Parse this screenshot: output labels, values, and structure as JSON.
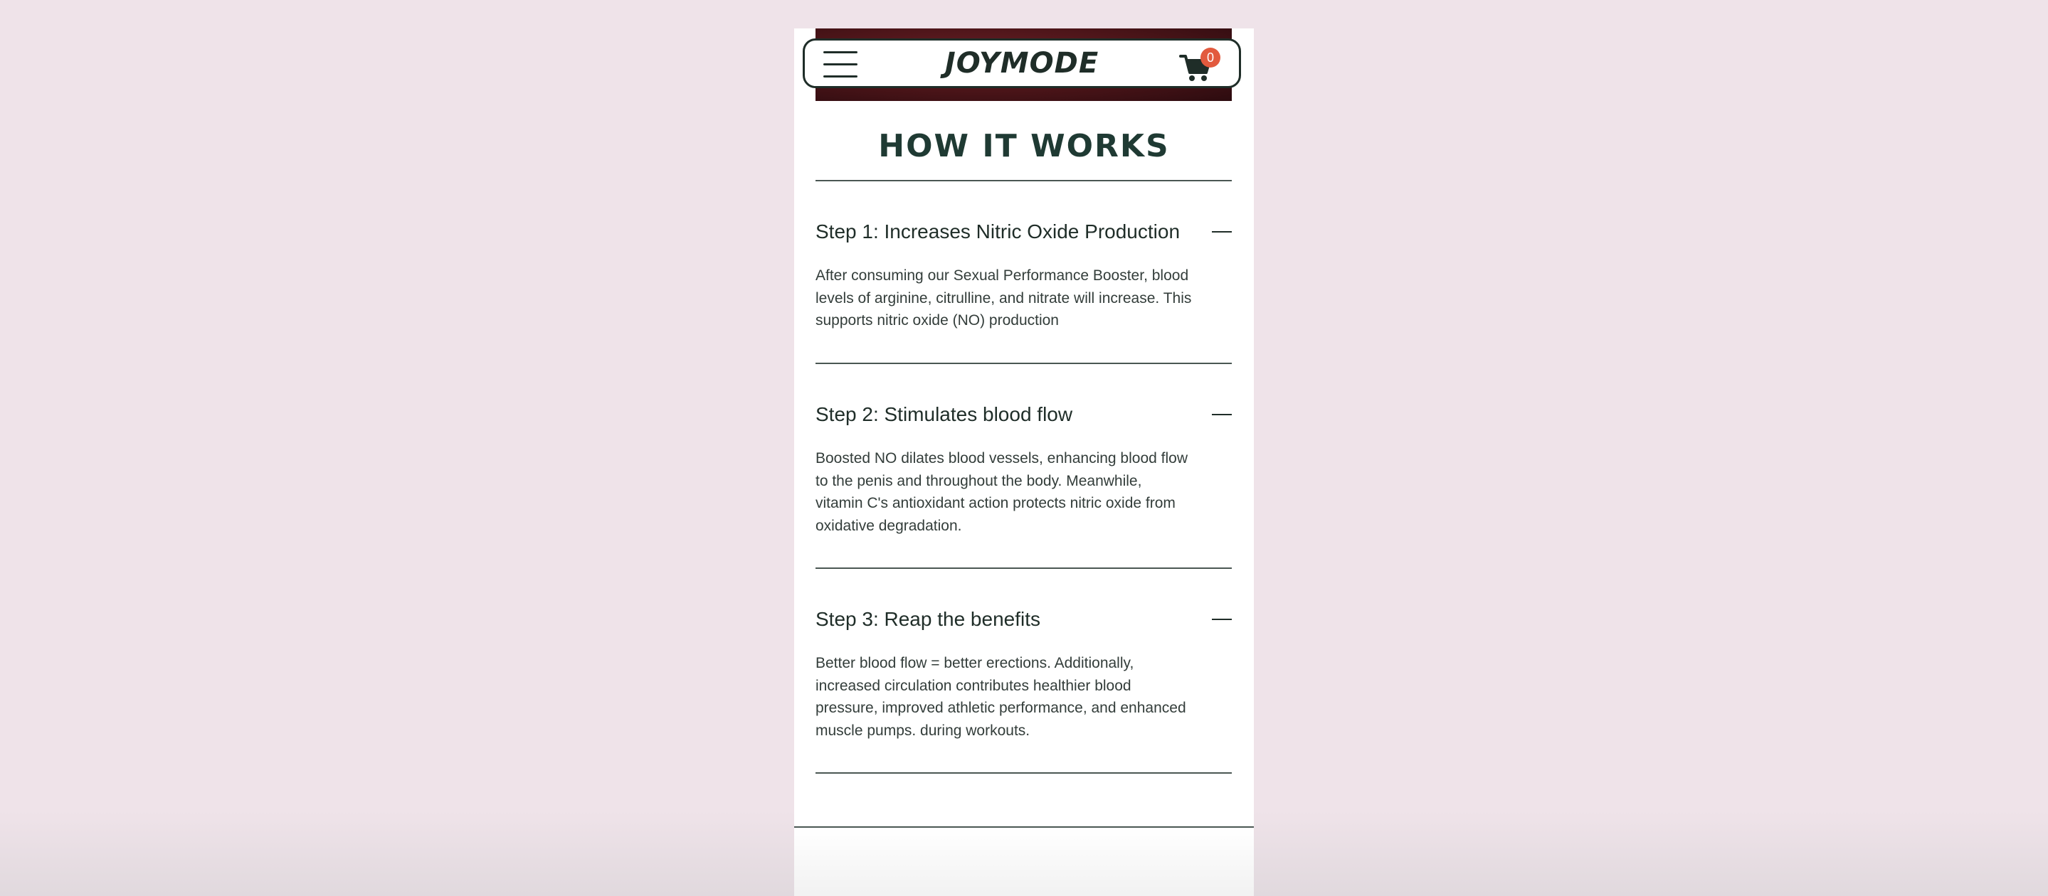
{
  "header": {
    "logo": "JOYMODE",
    "cart_count": "0"
  },
  "section": {
    "title": "HOW IT WORKS"
  },
  "steps": [
    {
      "title": "Step 1: Increases Nitric Oxide Production",
      "body": "After consuming our Sexual Performance Booster, blood levels of arginine, citrulline, and nitrate will increase. This supports nitric oxide (NO) production"
    },
    {
      "title": "Step 2: Stimulates blood flow",
      "body": "Boosted NO dilates blood vessels, enhancing blood flow to the penis and throughout the body. Meanwhile, vitamin C's antioxidant action protects nitric oxide from oxidative degradation."
    },
    {
      "title": "Step 3: Reap the benefits",
      "body": "Better blood flow = better erections. Additionally, increased circulation contributes healthier blood pressure, improved athletic performance, and enhanced muscle pumps. during workouts."
    }
  ],
  "icons": {
    "menu": "hamburger-menu-icon",
    "cart": "shopping-cart-icon",
    "collapse": "minus-icon"
  },
  "colors": {
    "background": "#efe3e9",
    "text_dark": "#1f2d28",
    "heading": "#1f3a33",
    "badge": "#e25a3e"
  }
}
